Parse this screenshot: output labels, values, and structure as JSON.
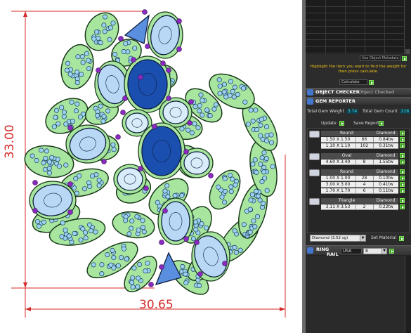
{
  "viewport": {
    "width_dimension": "30.65",
    "height_dimension": "33.00"
  },
  "panel": {
    "unit_dropdown": "Usa Object Metadata",
    "hint": "Highlight the item you want to find the weight for then press calculate.",
    "calculate_label": "Calculate",
    "object_checker_label": "OBJECT CHECKER",
    "object_checked_label": "Object Checked",
    "gem_reporter_label": "GEM REPORTER",
    "total_gem_weight_label": "Total Gem Weight",
    "total_gem_weight_value": "3.74",
    "total_gem_count_label": "Total Gem Count",
    "total_gem_count_value": "216",
    "update_label": "Update",
    "save_report_label": "Save Report",
    "gem_groups": [
      {
        "shape": "Round",
        "material": "Diamond",
        "rows": [
          {
            "size": "1.50 X 1.50",
            "count": "66",
            "weight": "0.84tw"
          },
          {
            "size": "1.10 X 1.10",
            "count": "102",
            "weight": "0.31tw"
          }
        ]
      },
      {
        "shape": "Oval",
        "material": "Diamond",
        "rows": [
          {
            "size": "4.60 X 3.40",
            "count": "8",
            "weight": "1.55tw"
          }
        ]
      },
      {
        "shape": "Round",
        "material": "Diamond",
        "rows": [
          {
            "size": "1.00 X 1.00",
            "count": "28",
            "weight": "0.10tw"
          },
          {
            "size": "3.00 X 3.00",
            "count": "4",
            "weight": "0.41tw"
          },
          {
            "size": "1.70 X 1.70",
            "count": "6",
            "weight": "0.11tw"
          }
        ]
      },
      {
        "shape": "Triangle",
        "material": "Diamond",
        "rows": [
          {
            "size": "3.11 X 3.53",
            "count": "2",
            "weight": "0.22tw"
          }
        ]
      }
    ],
    "material_select": "Diamond (3.52 sg)",
    "set_material_label": "Set Material",
    "ring_label_1": "RING",
    "ring_label_2": "RAIL",
    "ring_standard": "USA",
    "ring_size": "8"
  }
}
